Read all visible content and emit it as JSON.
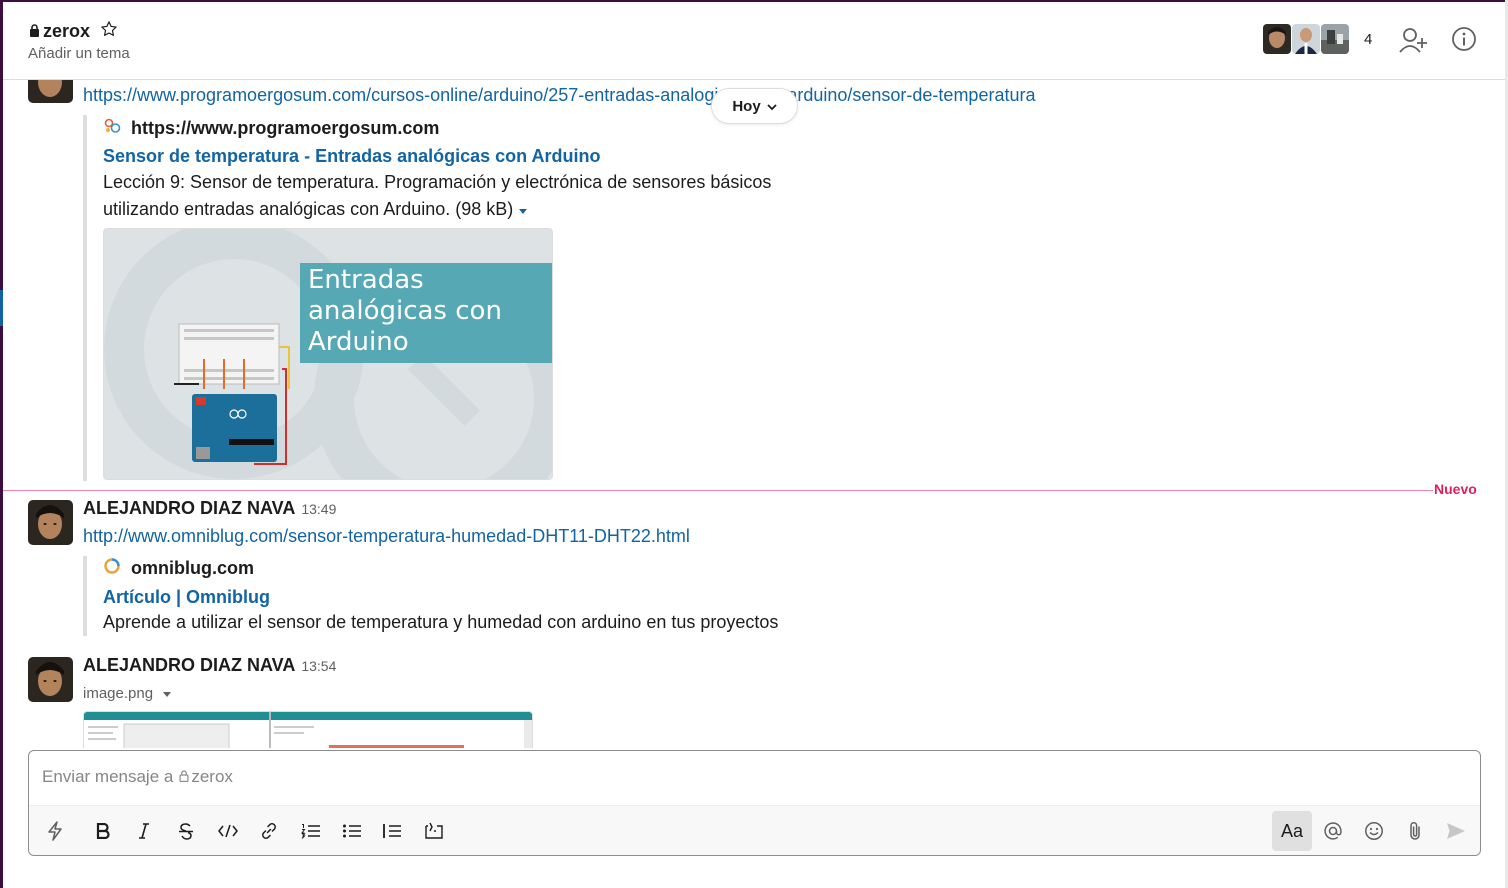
{
  "header": {
    "channel_name": "zerox",
    "topic_placeholder": "Añadir un tema",
    "member_count": "4"
  },
  "date_pill": {
    "label": "Hoy"
  },
  "messages": [
    {
      "link_text": "https://www.programoergosum.com/cursos-online/arduino/257-entradas-analogicas-con-arduino/sensor-de-temperatura",
      "attachment": {
        "site": "https://www.programoergosum.com",
        "title": "Sensor de temperatura - Entradas analógicas con Arduino",
        "description_line1": "Lección 9: Sensor de temperatura. Programación y electrónica de sensores básicos",
        "description_line2": "utilizando entradas analógicas con Arduino. (98 kB)",
        "image_caption": "Entradas analógicas con Arduino"
      }
    },
    {
      "sender": "ALEJANDRO DIAZ NAVA",
      "time": "13:49",
      "link_text": "http://www.omniblug.com/sensor-temperatura-humedad-DHT11-DHT22.html",
      "attachment": {
        "site": "omniblug.com",
        "title": "Artículo | Omniblug",
        "description": "Aprende a utilizar el sensor de temperatura y humedad con arduino en tus proyectos"
      }
    },
    {
      "sender": "ALEJANDRO DIAZ NAVA",
      "time": "13:54",
      "file_name": "image.png"
    }
  ],
  "new_divider": {
    "label": "Nuevo"
  },
  "composer": {
    "placeholder_prefix": "Enviar mensaje a",
    "placeholder_channel": "zerox",
    "aa_label": "Aa"
  },
  "colors": {
    "link": "#1264a3",
    "new_divider": "#e01e5a",
    "sidebar_aubergine": "#3f0e40"
  }
}
